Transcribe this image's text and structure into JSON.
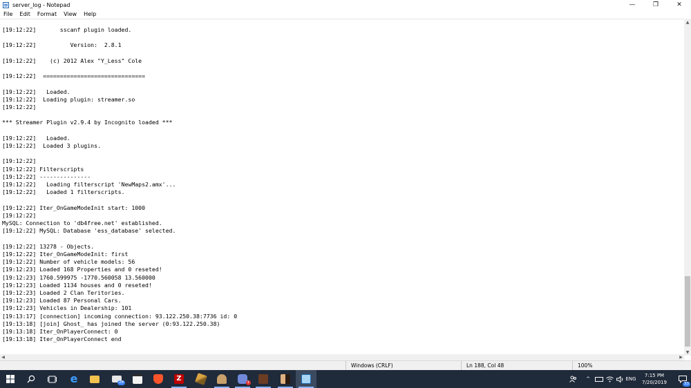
{
  "window": {
    "title": "server_log - Notepad",
    "controls": {
      "minimize": "—",
      "restore": "❐",
      "close": "✕"
    }
  },
  "menu": [
    "File",
    "Edit",
    "Format",
    "View",
    "Help"
  ],
  "content": {
    "lines": [
      "[19:12:22]       sscanf plugin loaded.",
      "",
      "[19:12:22]          Version:  2.8.1",
      "",
      "[19:12:22]    (c) 2012 Alex \"Y_Less\" Cole",
      "",
      "[19:12:22]  ==============================",
      "",
      "[19:12:22]   Loaded.",
      "[19:12:22]  Loading plugin: streamer.so",
      "[19:12:22]",
      "",
      "*** Streamer Plugin v2.9.4 by Incognito loaded ***",
      "",
      "[19:12:22]   Loaded.",
      "[19:12:22]  Loaded 3 plugins.",
      "",
      "[19:12:22]",
      "[19:12:22] Filterscripts",
      "[19:12:22] ---------------",
      "[19:12:22]   Loading filterscript 'NewMaps2.amx'...",
      "[19:12:22]   Loaded 1 filterscripts.",
      "",
      "[19:12:22] Iter_OnGameModeInit start: 1000",
      "[19:12:22]",
      "MySQL: Connection to 'db4free.net' established.",
      "[19:12:22] MySQL: Database 'ess_database' selected.",
      "",
      "[19:12:22] 13278 - Objects.",
      "[19:12:22] Iter_OnGameModeInit: first",
      "[19:12:22] Number of vehicle models: 56",
      "[19:12:23] Loaded 168 Properties and 0 reseted!",
      "[19:12:23] 1760.599975 -1770.560058 13.560000",
      "[19:12:23] Loaded 1134 houses and 0 reseted!",
      "[19:12:23] Loaded 2 Clan Teritories.",
      "[19:12:23] Loaded 87 Personal Cars.",
      "[19:12:23] Vehicles in Dealership: 101",
      "[19:13:17] [connection] incoming connection: 93.122.250.38:7736 id: 0",
      "[19:13:18] [join] Ghost_ has joined the server (0:93.122.250.38)",
      "[19:13:18] Iter_OnPlayerConnect: 0",
      "[19:13:18] Iter_OnPlayerConnect end"
    ]
  },
  "scrollbar": {
    "up": "▲",
    "down": "▼",
    "left": "◀",
    "right": "▶"
  },
  "status": {
    "line_ending": "Windows (CRLF)",
    "position": "Ln 188, Col 48",
    "zoom": "100%"
  },
  "taskbar": {
    "mail_badge": "28",
    "discord_badge": "1",
    "tray": {
      "chevron": "^",
      "language": "ENG"
    },
    "time": "7:15 PM",
    "date": "7/20/2019",
    "notification_count": "33"
  },
  "colors": {
    "taskbar": "#1f2a3a",
    "status_bar": "#f0f0f0",
    "accent": "#0078d7"
  }
}
